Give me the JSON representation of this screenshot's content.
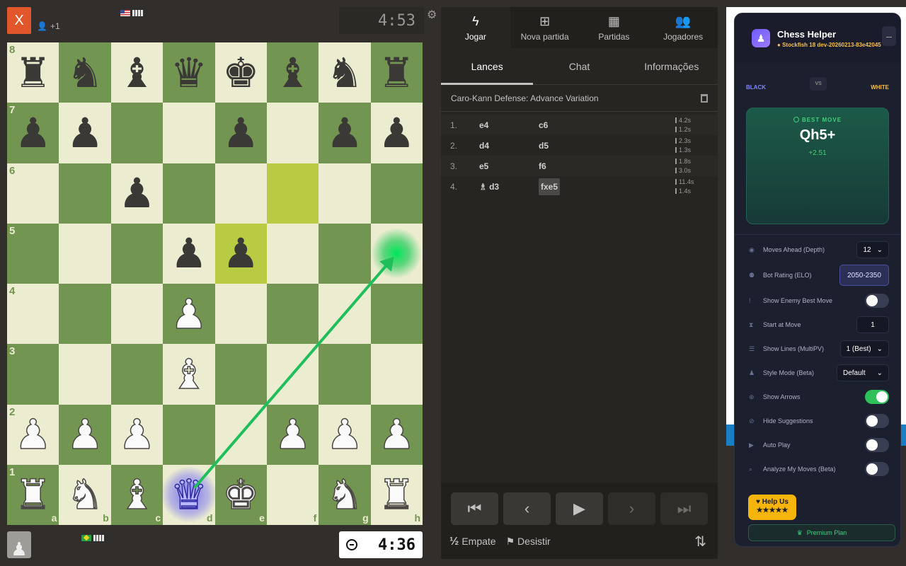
{
  "game": {
    "close_label": "X",
    "top_player_extra": "+1",
    "top_clock": "4:53",
    "bottom_clock": "4:36"
  },
  "board": {
    "ranks": [
      "8",
      "7",
      "6",
      "5",
      "4",
      "3",
      "2",
      "1"
    ],
    "files": [
      "a",
      "b",
      "c",
      "d",
      "e",
      "f",
      "g",
      "h"
    ],
    "rows": [
      [
        "br",
        "bn",
        "bb",
        "bq",
        "bk",
        "bb",
        "bn",
        "br"
      ],
      [
        "bp",
        "bp",
        "",
        "",
        "bp",
        "",
        "bp",
        "bp"
      ],
      [
        "",
        "",
        "bp",
        "",
        "",
        "",
        "",
        ""
      ],
      [
        "",
        "",
        "",
        "bp",
        "bp",
        "",
        "",
        ""
      ],
      [
        "",
        "",
        "",
        "wp",
        "",
        "",
        "",
        ""
      ],
      [
        "",
        "",
        "",
        "wb",
        "",
        "",
        "",
        ""
      ],
      [
        "wp",
        "wp",
        "wp",
        "",
        "",
        "wp",
        "wp",
        "wp"
      ],
      [
        "wr",
        "wn",
        "wb",
        "wq",
        "wk",
        "",
        "wn",
        "wr"
      ]
    ],
    "highlighted_squares": [
      "f6",
      "e5"
    ],
    "arrow": {
      "from": "d1",
      "to": "h5",
      "color": "#1ebe5a"
    }
  },
  "panel": {
    "tabs": [
      {
        "icon": "lightning-icon",
        "glyph": "ϟ",
        "label": "Jogar"
      },
      {
        "icon": "plus-square-icon",
        "glyph": "⊞",
        "label": "Nova partida"
      },
      {
        "icon": "checkerboard-icon",
        "glyph": "▦",
        "label": "Partidas"
      },
      {
        "icon": "users-icon",
        "glyph": "👥",
        "label": "Jogadores"
      }
    ],
    "subtabs": [
      "Lances",
      "Chat",
      "Informações"
    ],
    "opening": "Caro-Kann Defense: Advance Variation",
    "moves": [
      {
        "num": "1.",
        "white": "e4",
        "black": "c6",
        "wtime": "4.2s",
        "btime": "1.2s"
      },
      {
        "num": "2.",
        "white": "d4",
        "black": "d5",
        "wtime": "2.3s",
        "btime": "1.3s"
      },
      {
        "num": "3.",
        "white": "e5",
        "black": "f6",
        "wtime": "1.8s",
        "btime": "3.0s"
      },
      {
        "num": "4.",
        "white": "d3",
        "white_piece": "♗",
        "black": "fxe5",
        "wtime": "11.4s",
        "btime": "1.4s"
      }
    ],
    "nav_icons": [
      "first-move-icon",
      "prev-move-icon",
      "play-icon",
      "next-move-icon",
      "last-move-icon"
    ],
    "draw_label": "Empate",
    "resign_label": "Desistir"
  },
  "helper": {
    "title": "Chess Helper",
    "version": "Stockfish 18 dev-20260213-83e42045",
    "black_label": "BLACK",
    "vs_label": "VS",
    "white_label": "WHITE",
    "best_move_label": "BEST MOVE",
    "best_move": "Qh5+",
    "eval": "+2.51",
    "settings": {
      "depth_label": "Moves Ahead (Depth)",
      "depth_value": "12",
      "elo_label": "Bot Rating (ELO)",
      "elo_value": "2050-2350",
      "enemy_label": "Show Enemy Best Move",
      "start_label": "Start at Move",
      "start_value": "1",
      "lines_label": "Show Lines (MultiPV)",
      "lines_value": "1 (Best)",
      "style_label": "Style Mode (Beta)",
      "style_value": "Default",
      "arrows_label": "Show Arrows",
      "hide_label": "Hide Suggestions",
      "autoplay_label": "Auto Play",
      "analyze_label": "Analyze My Moves (Beta)"
    },
    "toggles": {
      "enemy": false,
      "arrows": true,
      "hide": false,
      "autoplay": false,
      "analyze": false
    },
    "help_label": "Help Us",
    "help_stars": "★★★★★",
    "premium_label": "Premium Plan"
  }
}
